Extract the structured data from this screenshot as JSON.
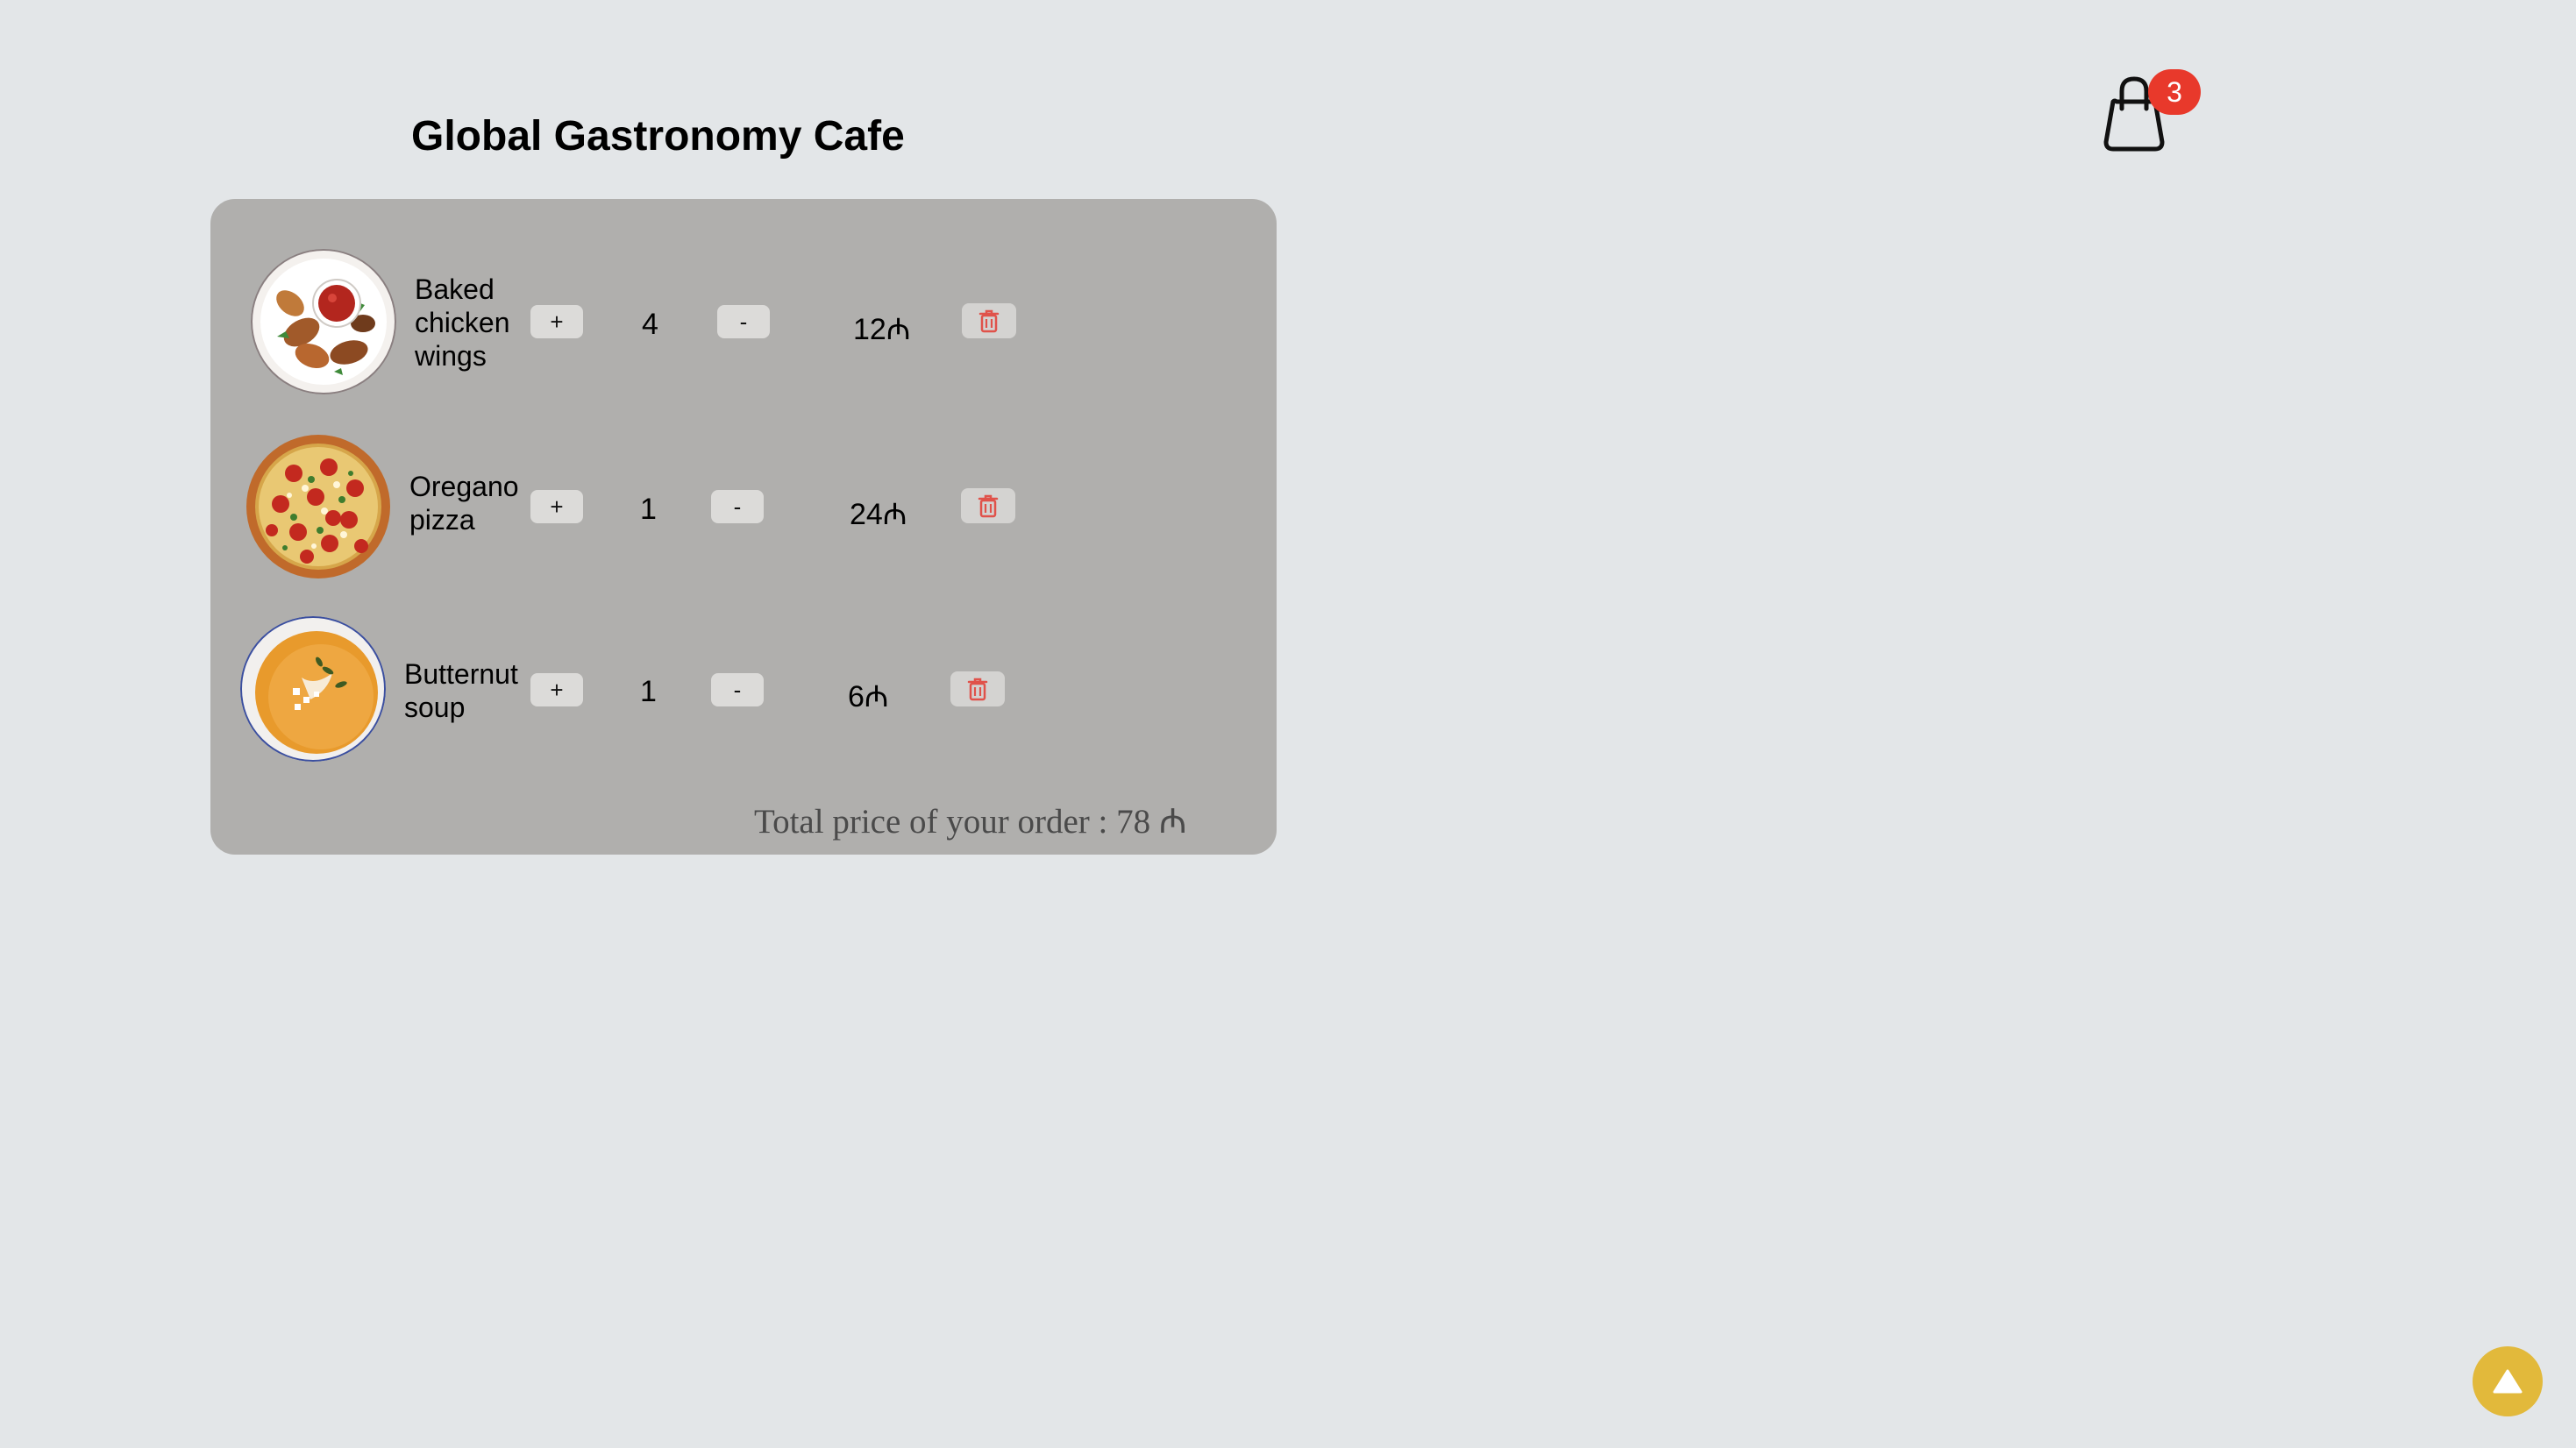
{
  "header": {
    "title": "Global Gastronomy Cafe"
  },
  "cart": {
    "count": "3",
    "icon": "shopping-bag-icon",
    "badge_color": "#e8392b"
  },
  "order": {
    "items": [
      {
        "name": "Baked chicken wings",
        "plus": "+",
        "quantity": "4",
        "minus": "-",
        "price": "12₼",
        "image": "chicken-wings"
      },
      {
        "name": "Oregano pizza",
        "plus": "+",
        "quantity": "1",
        "minus": "-",
        "price": "24₼",
        "image": "pizza"
      },
      {
        "name": "Butternut soup",
        "plus": "+",
        "quantity": "1",
        "minus": "-",
        "price": "6₼",
        "image": "soup"
      }
    ],
    "total_text": "Total price of your order : 78 ₼"
  },
  "colors": {
    "background": "#e3e6e8",
    "panel": "#b0afad",
    "delete_icon": "#e0524a",
    "scroll_top": "#e2b93b"
  },
  "scroll_top": {
    "icon": "triangle-up-icon"
  }
}
